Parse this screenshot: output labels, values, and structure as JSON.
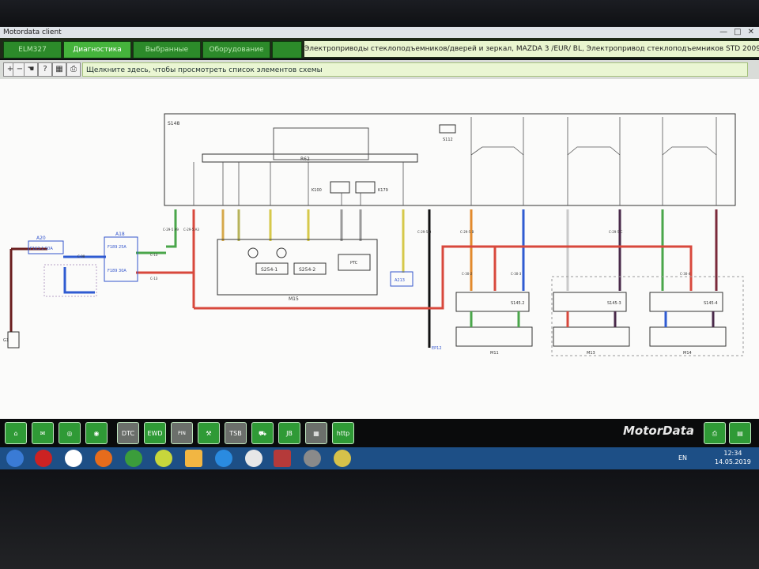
{
  "window": {
    "title": "Motordata client",
    "buttons": [
      "—",
      "□",
      "✕"
    ]
  },
  "tabs": [
    {
      "label": "ELM327",
      "active": false
    },
    {
      "label": "Диагностика",
      "active": true
    },
    {
      "label": "Выбранные схемы",
      "active": false
    },
    {
      "label": "Оборудование",
      "active": false
    }
  ],
  "breadcrumb": "Электроприводы стеклоподъемников/дверей и зеркал, MAZDA 3 /EUR/ BL, Электропривод стеклоподъемников STD 2009",
  "toolbar": {
    "tools": [
      "zoom-in-icon",
      "zoom-out-icon",
      "hand-icon",
      "fit-icon",
      "search-icon",
      "help-icon",
      "color-icon",
      "print-icon"
    ],
    "hint": "Щелкните здесь, чтобы просмотреть список элементов схемы"
  },
  "schematic": {
    "blocks": {
      "s148": "S148",
      "r62": "R62",
      "k100": "K100",
      "k179": "K179",
      "s112": "S112",
      "m15": "M15",
      "s254_1": "S254-1",
      "s254_2": "S254-2",
      "a20": "A20",
      "a18": "A18",
      "f163": "F163-1 50A",
      "f189_25": "F189 25A",
      "f189_30": "F189 30A",
      "a213": "A213",
      "g1": "G1",
      "ep12": "EP12",
      "s145_2": "S145.2",
      "s145_3": "S145-3",
      "s145_4": "S145-4",
      "m11": "M11",
      "m13": "M13",
      "m14": "M14",
      "ptc": "PTC"
    },
    "connectors": [
      "C-29-5 A9",
      "C-29-5 A3",
      "C-13",
      "C-13",
      "C-29-5 B",
      "C-29-5 B",
      "C-29-5 C",
      "C-30-2",
      "C-30-3",
      "C-30-4",
      "C-98",
      "EP12"
    ]
  },
  "bottom_buttons": [
    {
      "icon": "home-icon",
      "label": ""
    },
    {
      "icon": "chat-icon",
      "label": ""
    },
    {
      "icon": "brake-icon",
      "label": ""
    },
    {
      "icon": "steering-icon",
      "label": ""
    },
    {
      "icon": "dtc-icon",
      "label": "DTC"
    },
    {
      "icon": "ewd-icon",
      "label": "EWD"
    },
    {
      "icon": "pin-data-icon",
      "label": "PIN DATA"
    },
    {
      "icon": "tools-icon",
      "label": ""
    },
    {
      "icon": "tsb-icon",
      "label": "TSB"
    },
    {
      "icon": "truck-icon",
      "label": ""
    },
    {
      "icon": "junction-icon",
      "label": "JB"
    },
    {
      "icon": "grid-icon",
      "label": ""
    },
    {
      "icon": "web-icon",
      "label": "http"
    }
  ],
  "brand": "MotorData",
  "taskbar": {
    "lang": "EN",
    "time": "12:34",
    "date": "14.05.2019",
    "apps": [
      "start-icon",
      "opera-icon",
      "yandex-icon",
      "firefox-icon",
      "chrome-icon",
      "at-icon",
      "notes-icon",
      "ie-icon",
      "clock-icon",
      "motordata-icon",
      "steering-app-icon",
      "paint-icon"
    ]
  },
  "colors": {
    "accent": "#2c8a2a",
    "wire_red": "#d8483c",
    "wire_green": "#4aa64a",
    "wire_blue": "#2f5bd1",
    "wire_orange": "#e28a2c",
    "wire_yellow": "#d6c84a",
    "wire_black": "#111111"
  }
}
